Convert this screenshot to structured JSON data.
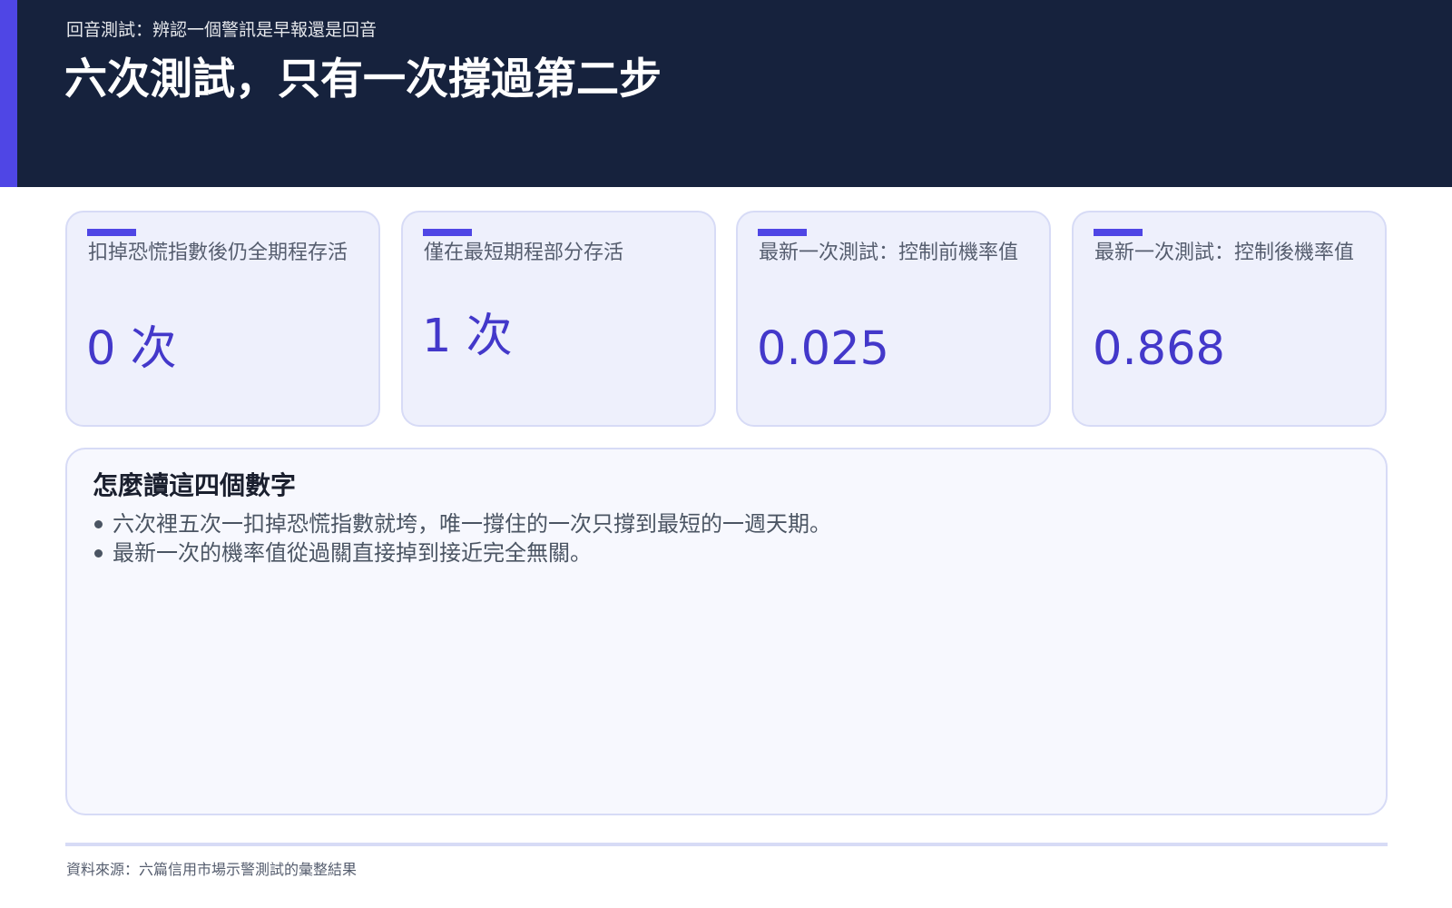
{
  "header": {
    "kicker": "回音測試：辨認一個警訊是早報還是回音",
    "title": "六次測試，只有一次撐過第二步"
  },
  "cards": [
    {
      "label": "扣掉恐慌指數後仍全期程存活",
      "value": "0 次"
    },
    {
      "label": "僅在最短期程部分存活",
      "value": "1 次"
    },
    {
      "label": "最新一次測試：控制前機率值",
      "value": "0.025"
    },
    {
      "label": "最新一次測試：控制後機率值",
      "value": "0.868"
    }
  ],
  "notes": {
    "title": "怎麼讀這四個數字",
    "items": [
      "六次裡五次一扣掉恐慌指數就垮，唯一撐住的一次只撐到最短的一週天期。",
      "最新一次的機率值從過關直接掉到接近完全無關。"
    ]
  },
  "footer": {
    "source": "資料來源：六篇信用市場示警測試的彙整結果"
  },
  "colors": {
    "header_bg": "#16223d",
    "accent": "#4f46e5",
    "value_text": "#4338ca",
    "card_bg": "#eef0fc"
  }
}
